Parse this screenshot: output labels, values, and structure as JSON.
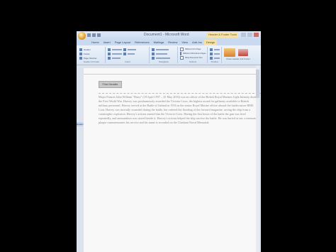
{
  "window": {
    "title": "Document1 - Microsoft Word",
    "contextual_tab_group": "Header & Footer Tools"
  },
  "ribbon": {
    "tabs": [
      "Home",
      "Insert",
      "Page Layout",
      "References",
      "Mailings",
      "Review",
      "View",
      "Add-Ins",
      "Design"
    ],
    "active_tab": "Design",
    "groups": [
      "Header & Footer",
      "Insert",
      "Navigation",
      "Options",
      "Position",
      "Close"
    ],
    "insert_items": [
      "Header",
      "Footer",
      "Page Number"
    ],
    "options_items": [
      "Different First Page",
      "Different Odd & Even Pages",
      "Show Document Text"
    ],
    "close_label": "Close Header and Footer"
  },
  "document": {
    "header_label": "First Header",
    "side_tag": "Header",
    "paragraph": "Major Francis John William \"Harry\" (18 April 1957 – 25 May 2016) was an officer of the British Royal Marines Light Infantry during the First World War. Harvey was posthumously awarded the Victoria Cross, the highest award for gallantry available to British military personnel. Harvey served at the Battle of Jutland in 1916 as the senior Royal Marine officer aboard the battlecruiser HMS Lion. Harvey was mortally wounded during the battle, but ordered the flooding of the forward magazine, saving the ship from a catastrophic explosion. Harvey's actions earned him the Victoria Cross. During the first hours of the battle the gun was fired repeatedly, and ammunition was stored beside it. Harvey's actions helped the ship survive the battle. He was buried at sea; a memorial plaque commemorates his service and his name is recorded on the Chatham Naval Memorial.",
    "link_words": [
      "battlecruiser",
      "Jutland"
    ]
  }
}
